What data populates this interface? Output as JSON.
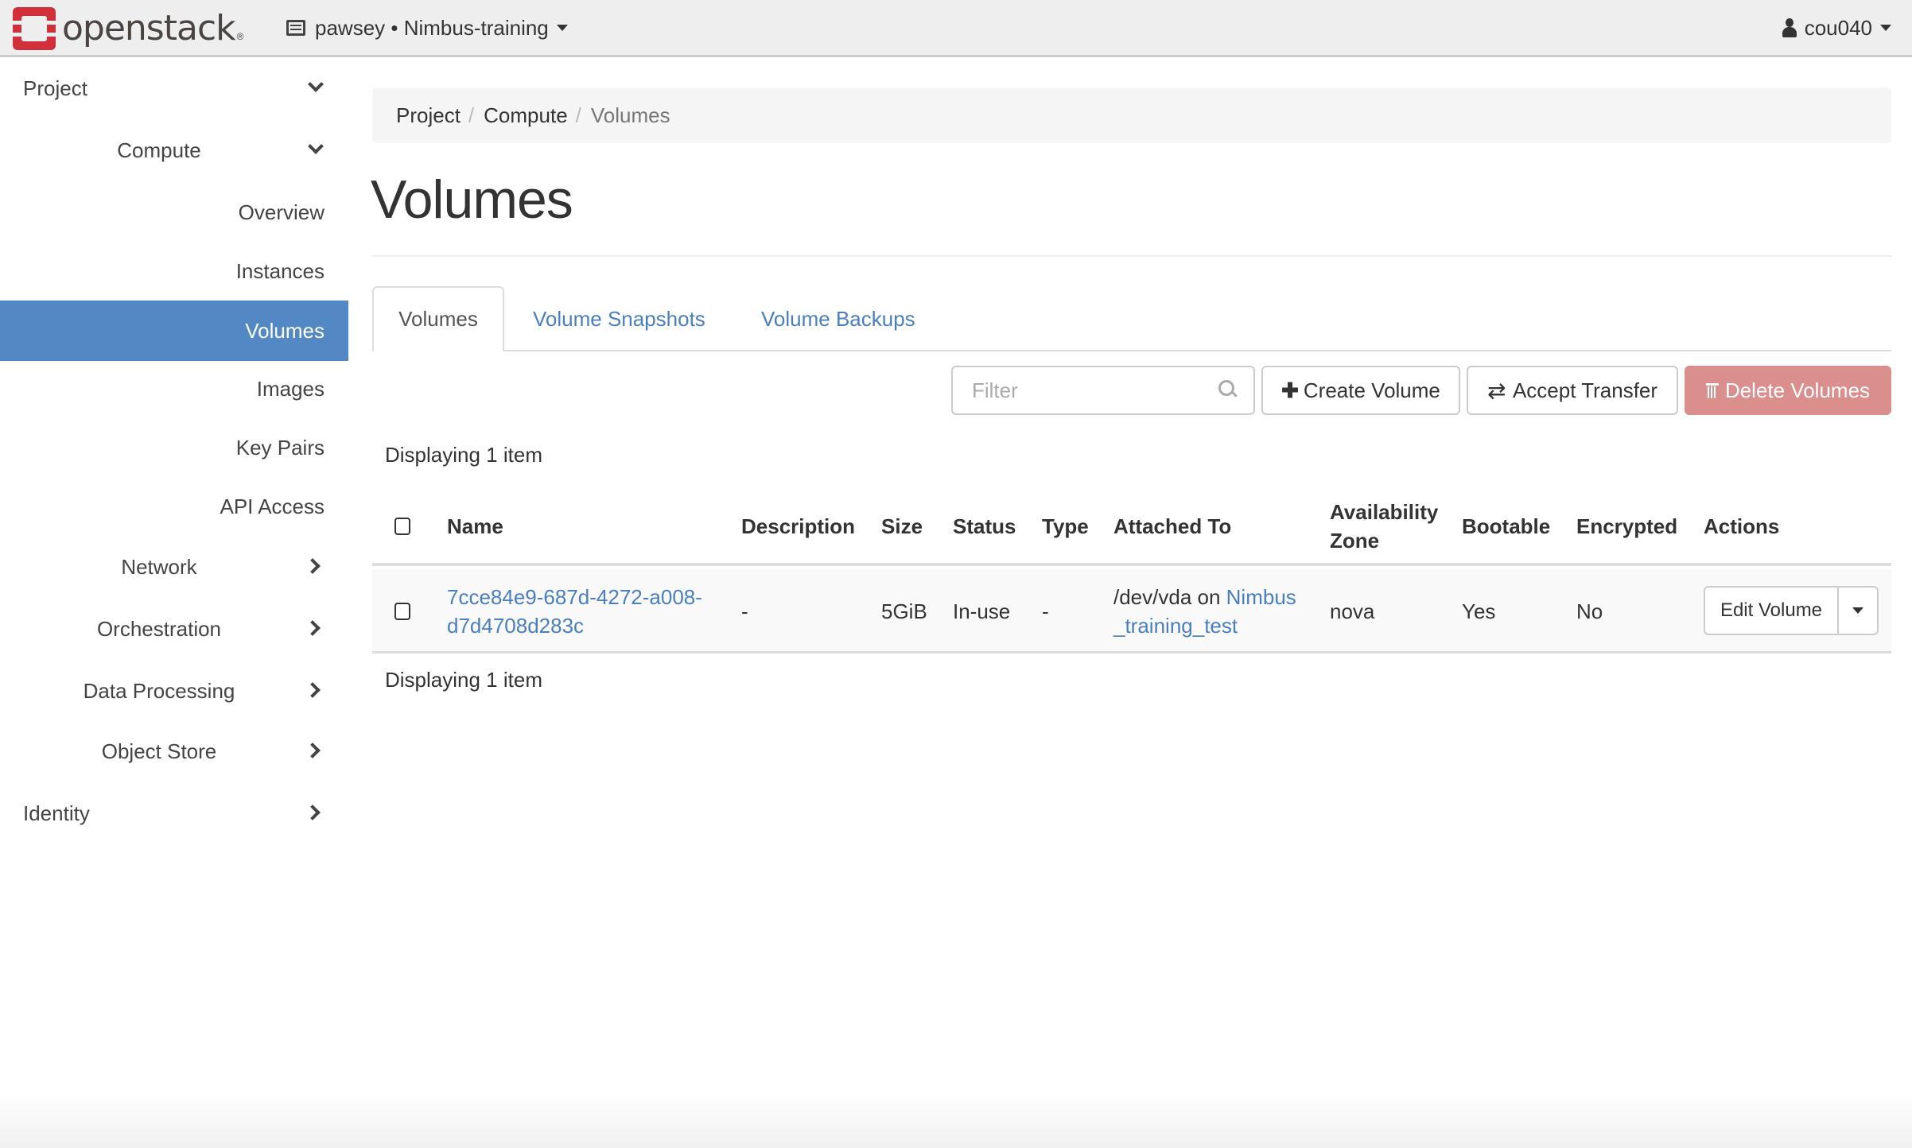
{
  "header": {
    "logo_text": "openstack",
    "logo_reg": "®",
    "project_switcher": "pawsey • Nimbus-training",
    "user": "cou040"
  },
  "sidebar": {
    "items": [
      {
        "label": "Project",
        "level": 0,
        "icon": "chevron-down-icon"
      },
      {
        "label": "Compute",
        "level": 1,
        "icon": "chevron-down-icon"
      },
      {
        "label": "Overview",
        "level": 2
      },
      {
        "label": "Instances",
        "level": 2
      },
      {
        "label": "Volumes",
        "level": 2,
        "active": true
      },
      {
        "label": "Images",
        "level": 2
      },
      {
        "label": "Key Pairs",
        "level": 2
      },
      {
        "label": "API Access",
        "level": 2
      },
      {
        "label": "Network",
        "level": 1,
        "icon": "chevron-right-icon"
      },
      {
        "label": "Orchestration",
        "level": 1,
        "icon": "chevron-right-icon"
      },
      {
        "label": "Data Processing",
        "level": 1,
        "icon": "chevron-right-icon"
      },
      {
        "label": "Object Store",
        "level": 1,
        "icon": "chevron-right-icon"
      },
      {
        "label": "Identity",
        "level": 0,
        "icon": "chevron-right-icon"
      }
    ],
    "active_color": "#5289c4"
  },
  "breadcrumb": [
    "Project",
    "Compute",
    "Volumes"
  ],
  "page_title": "Volumes",
  "tabs": [
    {
      "label": "Volumes",
      "active": true
    },
    {
      "label": "Volume Snapshots"
    },
    {
      "label": "Volume Backups"
    }
  ],
  "toolbar": {
    "filter_placeholder": "Filter",
    "filter_value": "",
    "create_label": "Create Volume",
    "accept_label": "Accept Transfer",
    "delete_label": "Delete Volumes"
  },
  "table": {
    "count_text": "Displaying 1 item",
    "columns": [
      "Name",
      "Description",
      "Size",
      "Status",
      "Type",
      "Attached To",
      "Availability Zone",
      "Bootable",
      "Encrypted",
      "Actions"
    ],
    "rows": [
      {
        "name": "7cce84e9-687d-4272-a008-d7d4708d283c",
        "name_line1": "7cce84e9-687d-4272-a008-",
        "name_line2": "d7d4708d283c",
        "description": "-",
        "size": "5GiB",
        "status": "In-use",
        "type": "-",
        "attached_prefix": "/dev/vda on ",
        "attached_link_line1": "Nimbus",
        "attached_link_line2": "_training_test",
        "availability_zone": "nova",
        "bootable": "Yes",
        "encrypted": "No",
        "action_label": "Edit Volume"
      }
    ]
  },
  "colors": {
    "link": "#4a7fbf",
    "danger": "#db8f8c",
    "brand": "#d1303a"
  }
}
